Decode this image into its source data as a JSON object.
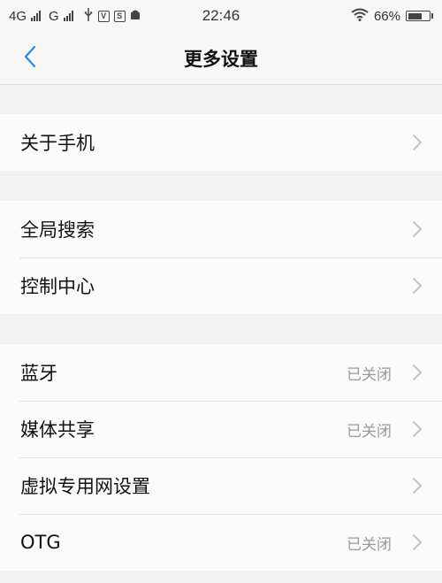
{
  "status_bar": {
    "network_1": "4G",
    "network_2": "G",
    "time": "22:46",
    "battery": "66%",
    "battery_level": 0.66
  },
  "header": {
    "title": "更多设置",
    "back_icon": "chevron-left-icon"
  },
  "settings": {
    "about": {
      "label": "关于手机"
    },
    "search": {
      "label": "全局搜索"
    },
    "control_center": {
      "label": "控制中心"
    },
    "bluetooth": {
      "label": "蓝牙",
      "status": "已关闭"
    },
    "media_share": {
      "label": "媒体共享",
      "status": "已关闭"
    },
    "vpn": {
      "label": "虚拟专用网设置"
    },
    "otg": {
      "label": "OTG",
      "status": "已关闭"
    }
  },
  "colors": {
    "accent": "#2a8de0",
    "background": "#f2f2f2",
    "row_background": "#fbfbfb",
    "secondary_text": "#9a9a9a"
  }
}
